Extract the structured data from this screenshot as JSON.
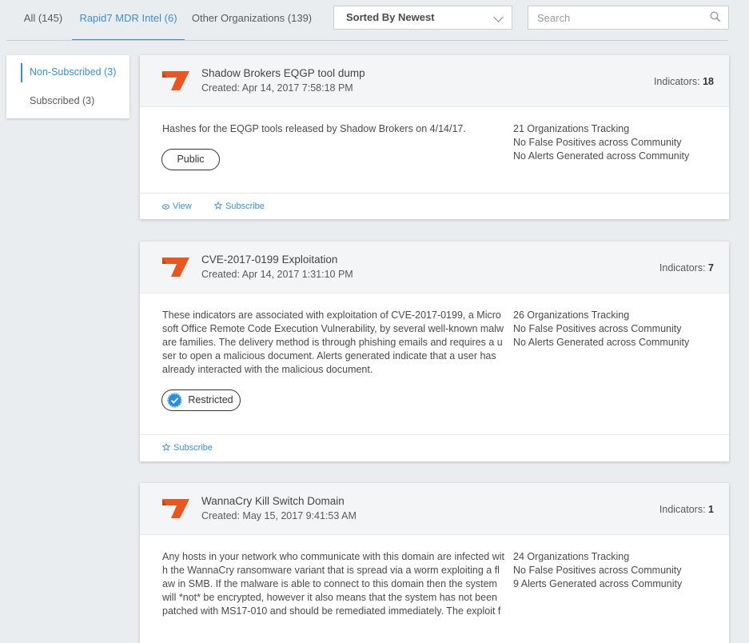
{
  "tabs": [
    {
      "label": "All (145)"
    },
    {
      "label": "Rapid7 MDR Intel (6)"
    },
    {
      "label": "Other Organizations (139)"
    }
  ],
  "sort": {
    "label": "Sorted By Newest"
  },
  "search": {
    "placeholder": "Search"
  },
  "sidebar": {
    "items": [
      {
        "label": "Non-Subscribed (3)"
      },
      {
        "label": "Subscribed (3)"
      }
    ]
  },
  "colors": {
    "accent": "#3b8fd0",
    "logo": "#e8571f"
  },
  "cards": [
    {
      "title": "Shadow Brokers EQGP tool dump",
      "created": "Created: Apr 14, 2017 7:58:18 PM",
      "indicators_label": "Indicators:",
      "indicators_value": "18",
      "description": "Hashes for the EQGP tools released by Shadow Brokers on 4/14/17.",
      "stats": [
        "21 Organizations Tracking",
        "No False Positives across Community",
        "No Alerts Generated across Community"
      ],
      "badge": "Public",
      "actions": [
        "View",
        "Subscribe"
      ]
    },
    {
      "title": "CVE-2017-0199 Exploitation",
      "created": "Created: Apr 14, 2017 1:31:10 PM",
      "indicators_label": "Indicators:",
      "indicators_value": "7",
      "description": "These indicators are associated with exploitation of CVE-2017-0199, a Microsoft Office Remote Code Execution Vulnerability, by several well-known malware families. The delivery method is through phishing emails and requires a user to open a malicious document. Alerts generated indicate that a user has already interacted with the malicious document.",
      "stats": [
        "26 Organizations Tracking",
        "No False Positives across Community",
        "No Alerts Generated across Community"
      ],
      "badge": "Restricted",
      "actions": [
        "Subscribe"
      ]
    },
    {
      "title": "WannaCry Kill Switch Domain",
      "created": "Created: May 15, 2017 9:41:53 AM",
      "indicators_label": "Indicators:",
      "indicators_value": "1",
      "description": "Any hosts in your network who communicate with this domain are infected with the WannaCry ransomware variant that is spread via a worm exploiting a flaw in SMB. If the malware is able to connect to this domain then the system will *not* be encrypted, however it also means that the system has not been patched with MS17-010 and should be remediated immediately. The exploit f",
      "stats": [
        "24 Organizations Tracking",
        "No False Positives across Community",
        "9 Alerts Generated across Community"
      ]
    }
  ]
}
